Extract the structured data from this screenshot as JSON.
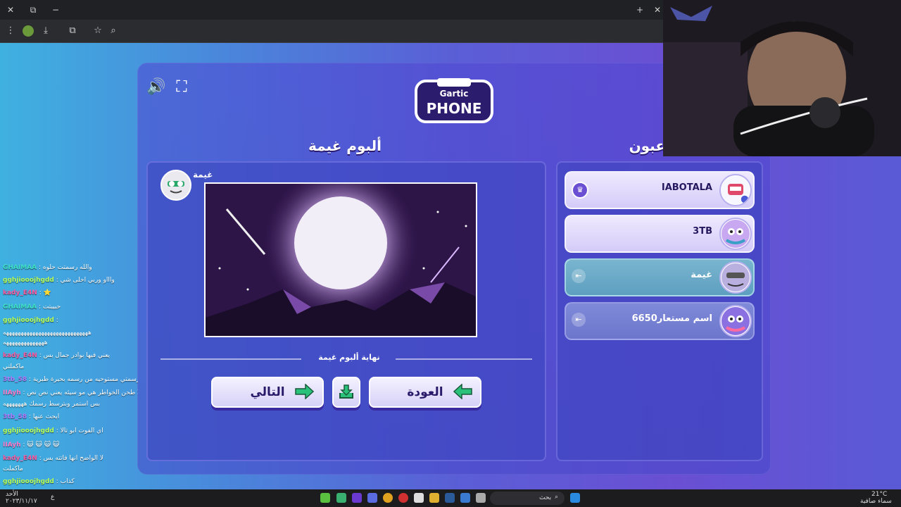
{
  "browser": {
    "close_glyph": "✕",
    "tabs_glyph": "⧉",
    "min_glyph": "−",
    "new_tab_glyph": "+",
    "menu_glyph": "⋮",
    "download_glyph": "⤓",
    "extensions_glyph": "⧉",
    "bookmark_glyph": "☆",
    "search_glyph": "⌕"
  },
  "game": {
    "album_title": "ألبوم غيمة",
    "players_title": "عبون",
    "author_name": "غيمة",
    "divider_text": "نهاية ألبوم غيمة",
    "next_label": "التالي",
    "back_label": "العودة",
    "sound_glyph": "🔊",
    "expand_glyph": "⛶",
    "players": [
      {
        "name": "IABOTALA",
        "status": "owner"
      },
      {
        "name": "3TB",
        "status": "active"
      },
      {
        "name": "غيمة",
        "status": "current"
      },
      {
        "name": "اسم مستعار6650",
        "status": "inactive"
      }
    ]
  },
  "chat": [
    {
      "user": "GHAIMAA",
      "text": ": والله رسمتت حلوه",
      "color": "#3fe0c8"
    },
    {
      "user": "gghjiooojhgdd",
      "text": ": واااو وربي احلى شي",
      "color": "#b7ff5a"
    },
    {
      "user": "kady_E4N",
      "text": ": ⭐",
      "color": "#ff5aa0"
    },
    {
      "user": "GHAIMAA",
      "text": ": حبيبتت",
      "color": "#3fe0c8"
    },
    {
      "user": "gghjiooojhgdd",
      "text": ":",
      "color": "#b7ff5a"
    },
    {
      "user": "",
      "text": "هههههههههههههههههههههههههههههه",
      "color": "#ffffff"
    },
    {
      "user": "",
      "text": "ههههههههههههههه",
      "color": "#ffffff"
    },
    {
      "user": "kady_E4N",
      "text": ": يعني فيها بوادر جمال بس",
      "color": "#ff5aa0"
    },
    {
      "user": "",
      "text": "ماكملتي",
      "color": "#ffffff"
    },
    {
      "user": "3tb_58",
      "text": ": رسمتي مستوحيه من رسمه بحيرة طبرية",
      "color": "#b07bff"
    },
    {
      "user": "IIAyh",
      "text": ": لالا طحن الخواطر هي مو سيئه يعني نص نص",
      "color": "#ff7ac8"
    },
    {
      "user": "",
      "text": "بس استمر وبترسط رسمك هههههههه",
      "color": "#ffffff"
    },
    {
      "user": "3tb_58",
      "text": ": ابحث عنها",
      "color": "#b07bff"
    },
    {
      "user": "gghjiooojhgdd",
      "text": ": اي الفوت ابو تالا",
      "color": "#b7ff5a"
    },
    {
      "user": "IIAyh",
      "text": ": 😺 😺 😺 😺",
      "color": "#ff7ac8"
    },
    {
      "user": "kady_E4N",
      "text": ": لا الواضح انها فاتته بس",
      "color": "#ff5aa0"
    },
    {
      "user": "",
      "text": "ماكملت",
      "color": "#ffffff"
    },
    {
      "user": "gghjiooojhgdd",
      "text": ": كذاب",
      "color": "#b7ff5a"
    }
  ],
  "taskbar": {
    "search_placeholder": "بحث",
    "weather_temp": "21°C",
    "weather_text": "سماء صافية",
    "lang": "ع",
    "date_line1": "الأحد",
    "date_line2": "٢٠٢٣/١١/١٧"
  },
  "colors": {
    "accent": "#6a4fd3",
    "bg_left": "#3fb1e0",
    "bg_right": "#5a5ad6"
  }
}
